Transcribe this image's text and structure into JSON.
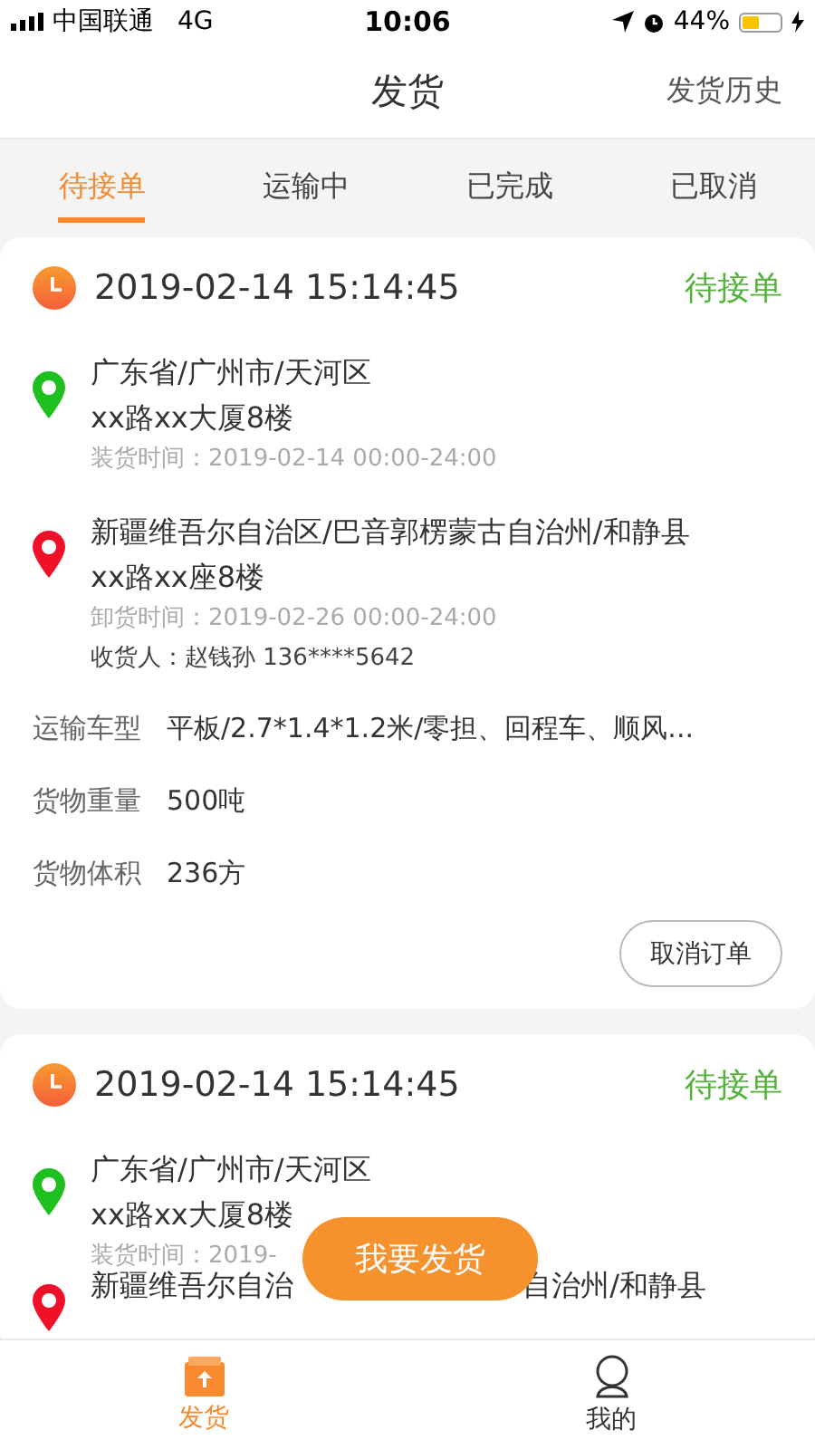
{
  "status_bar": {
    "carrier": "中国联通",
    "network": "4G",
    "time": "10:06",
    "battery": "44%"
  },
  "nav": {
    "title": "发货",
    "action": "发货历史"
  },
  "tabs": [
    {
      "label": "待接单",
      "selected": true
    },
    {
      "label": "运输中",
      "selected": false
    },
    {
      "label": "已完成",
      "selected": false
    },
    {
      "label": "已取消",
      "selected": false
    }
  ],
  "orders": [
    {
      "time": "2019-02-14 15:14:45",
      "status": "待接单",
      "pickup": {
        "region": "广东省/广州市/天河区",
        "street": "xx路xx大厦8楼",
        "time": "装货时间：2019-02-14  00:00-24:00"
      },
      "delivery": {
        "region": "新疆维吾尔自治区/巴音郭楞蒙古自治州/和静县",
        "street": "xx路xx座8楼",
        "time": "卸货时间：2019-02-26  00:00-24:00",
        "consignee": "收货人：赵钱孙   136****5642"
      },
      "details": [
        {
          "label": "运输车型",
          "value": "平板/2.7*1.4*1.2米/零担、回程车、顺风..."
        },
        {
          "label": "货物重量",
          "value": "500吨"
        },
        {
          "label": "货物体积",
          "value": "236方"
        }
      ],
      "cancel": "取消订单"
    },
    {
      "time": "2019-02-14 15:14:45",
      "status": "待接单",
      "pickup": {
        "region": "广东省/广州市/天河区",
        "street": "xx路xx大厦8楼",
        "time": "装货时间：2019-"
      },
      "delivery": {
        "region_parts": [
          "新疆维吾尔自治",
          "自治州/和静县"
        ]
      }
    }
  ],
  "fab": "我要发货",
  "bottom_tabs": [
    {
      "label": "发货",
      "kind": "ship",
      "selected": true
    },
    {
      "label": "我的",
      "kind": "profile",
      "selected": false
    }
  ]
}
